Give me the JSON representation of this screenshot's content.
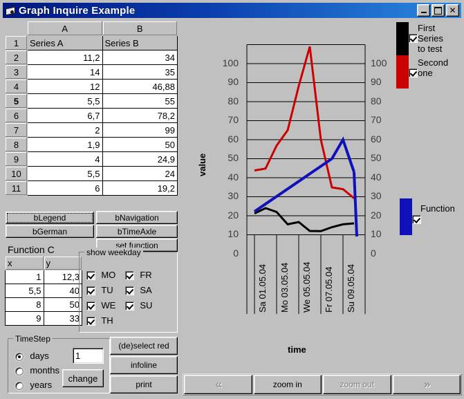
{
  "window": {
    "title": "Graph Inquire Example",
    "icon": "app-icon",
    "minimize_label": "_",
    "maximize_label": "□",
    "close_label": "✕"
  },
  "spreadsheet": {
    "columns": [
      "A",
      "B"
    ],
    "row_numbers": [
      "1",
      "2",
      "3",
      "4",
      "5",
      "6",
      "7",
      "8",
      "9",
      "10",
      "11"
    ],
    "selected_row": "5",
    "header_row": [
      "Series A",
      "Series B"
    ],
    "rows": [
      [
        "11,2",
        "34"
      ],
      [
        "14",
        "35"
      ],
      [
        "12",
        "46,88"
      ],
      [
        "5,5",
        "55"
      ],
      [
        "6,7",
        "78,2"
      ],
      [
        "2",
        "99"
      ],
      [
        "1,9",
        "50"
      ],
      [
        "4",
        "24,9"
      ],
      [
        "5,5",
        "24"
      ],
      [
        "6",
        "19,2"
      ]
    ]
  },
  "buttons": {
    "legend": "bLegend",
    "navigation": "bNavigation",
    "german": "bGerman",
    "timeaxle": "bTimeAxle",
    "set_function": "set function",
    "deselect_red": "(de)select red",
    "infoline": "infoline",
    "print": "print",
    "change": "change"
  },
  "function_table": {
    "title": "Function C",
    "columns": [
      "x",
      "y"
    ],
    "rows": [
      [
        "1",
        "12,3"
      ],
      [
        "5,5",
        "40"
      ],
      [
        "8",
        "50"
      ],
      [
        "9",
        "33"
      ]
    ]
  },
  "weekday": {
    "legend": "show weekday",
    "items": [
      {
        "label": "MO",
        "checked": true
      },
      {
        "label": "TU",
        "checked": true
      },
      {
        "label": "WE",
        "checked": true
      },
      {
        "label": "TH",
        "checked": true
      },
      {
        "label": "FR",
        "checked": true
      },
      {
        "label": "SA",
        "checked": true
      },
      {
        "label": "SU",
        "checked": true
      }
    ]
  },
  "timestep": {
    "legend": "TimeStep",
    "options": [
      "days",
      "months",
      "years"
    ],
    "selected": "days",
    "value": "1"
  },
  "nav": {
    "prev": "«",
    "zoom_in": "zoom in",
    "zoom_out": "zoom out",
    "next": "»"
  },
  "chart_data": {
    "type": "line",
    "title": "",
    "xlabel": "time",
    "ylabel": "value",
    "ylim": [
      0,
      100
    ],
    "yticks": [
      0,
      10,
      20,
      30,
      40,
      50,
      60,
      70,
      80,
      90,
      100
    ],
    "grid": true,
    "legend_position": "right",
    "x_tick_labels": [
      "Sa 01.05.04",
      "Mo 03.05.04",
      "We 05.05.04",
      "Fr 07.05.04",
      "Su 09.05.04"
    ],
    "x_index": [
      1,
      2,
      3,
      4,
      5,
      6,
      7,
      8,
      9,
      10
    ],
    "series": [
      {
        "name": "First Series to test",
        "color": "#000000",
        "checked": true,
        "values": [
          11.2,
          14,
          12,
          5.5,
          6.7,
          2,
          1.9,
          4,
          5.5,
          6
        ]
      },
      {
        "name": "Second one",
        "color": "#cc0000",
        "checked": true,
        "values": [
          34,
          35,
          46.88,
          55,
          78.2,
          99,
          50,
          24.9,
          24,
          19.2
        ]
      },
      {
        "name": "Function",
        "color": "#1111bb",
        "checked": true,
        "x": [
          1,
          5.5,
          8,
          9
        ],
        "values": [
          12.3,
          40,
          50,
          33
        ]
      }
    ],
    "legend_top": [
      {
        "label_lines": [
          "First",
          "Series",
          "to test"
        ],
        "color": "#000000",
        "checked": true
      },
      {
        "label_lines": [
          "Second",
          "one"
        ],
        "color": "#cc0000",
        "checked": true
      }
    ],
    "legend_right": [
      {
        "label": "Function",
        "color": "#1111bb",
        "checked": true
      }
    ]
  }
}
